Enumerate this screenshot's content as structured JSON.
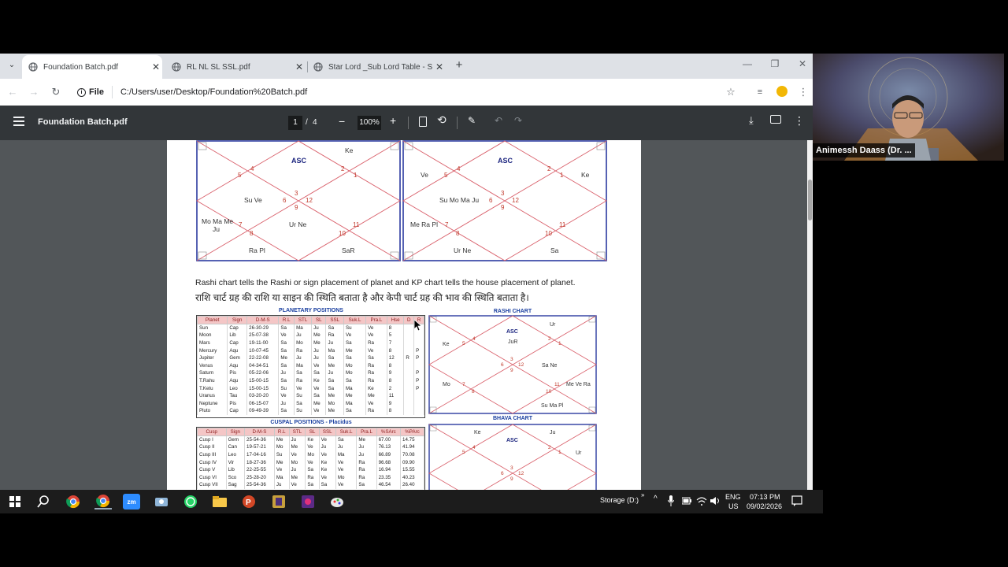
{
  "browser": {
    "tabs": [
      {
        "label": "Foundation Batch.pdf",
        "active": true
      },
      {
        "label": "RL NL SL SSL.pdf",
        "active": false
      },
      {
        "label": "Star Lord _Sub Lord Table - S",
        "active": false
      }
    ],
    "address": {
      "chip": "File",
      "url": "C:/Users/user/Desktop/Foundation%20Batch.pdf"
    }
  },
  "pdf": {
    "title": "Foundation Batch.pdf",
    "page_current": "1",
    "page_sep": "/",
    "page_total": "4",
    "zoom": "100%",
    "chart_left": {
      "asc": "ASC",
      "nums": [
        "4",
        "2",
        "5",
        "1",
        "3",
        "6",
        "12",
        "9",
        "7",
        "11",
        "8",
        "10"
      ],
      "houses": {
        "h1": "",
        "h2": "",
        "h3": "Ke",
        "h4": "Su Ve",
        "h5": "",
        "h6": "",
        "h7": "Ra Pl",
        "h8": "",
        "h9": "",
        "h10": "Ur Ne",
        "h11": "SaR",
        "h12": ""
      },
      "left_top": "Mo Ma Me",
      "left_bot": "Ju"
    },
    "chart_right": {
      "asc": "ASC",
      "nums": [
        "4",
        "2",
        "5",
        "1",
        "3",
        "6",
        "12",
        "9",
        "7",
        "11",
        "8",
        "10"
      ],
      "houses": {
        "tl": "Ve",
        "tr": "Ke",
        "mid_left": "Su Mo Ma Ju",
        "bl": "Me Ra Pl",
        "bottom": "Ur Ne",
        "br": "Sa"
      }
    },
    "sentence_en": "Rashi chart tells the Rashi or sign placement of planet and KP chart tells the house placement of planet.",
    "sentence_hi": "राशि चार्ट ग्रह की राशि या साइन की स्थिति बताता है और केपी चार्ट ग्रह की भाव की स्थिति बताता है।",
    "planetary": {
      "caption": "PLANETARY POSITIONS",
      "headers": [
        "Planet",
        "Sign",
        "D-M-S",
        "R.L",
        "STL",
        "SL",
        "SSL",
        "Suk.L",
        "Pra.L",
        "Hse",
        "D",
        "R"
      ],
      "rows": [
        [
          "Sun",
          "Cap",
          "26-30-29",
          "Sa",
          "Ma",
          "Ju",
          "Sa",
          "Su",
          "Ve",
          "8",
          "",
          ""
        ],
        [
          "Moon",
          "Lib",
          "25-07-38",
          "Ve",
          "Ju",
          "Me",
          "Ra",
          "Ve",
          "Ve",
          "5",
          "",
          ""
        ],
        [
          "Mars",
          "Cap",
          "19-11-00",
          "Sa",
          "Mo",
          "Me",
          "Ju",
          "Sa",
          "Ra",
          "7",
          "",
          ""
        ],
        [
          "Mercury",
          "Aqu",
          "10-07-45",
          "Sa",
          "Ra",
          "Ju",
          "Ma",
          "Me",
          "Ve",
          "8",
          "",
          "P"
        ],
        [
          "Jupiter",
          "Gem",
          "22-22-08",
          "Me",
          "Ju",
          "Ju",
          "Sa",
          "Sa",
          "Sa",
          "12",
          "R",
          "P"
        ],
        [
          "Venus",
          "Aqu",
          "04-34-51",
          "Sa",
          "Ma",
          "Ve",
          "Me",
          "Mo",
          "Ra",
          "8",
          "",
          ""
        ],
        [
          "Saturn",
          "Pis",
          "05-22-06",
          "Ju",
          "Sa",
          "Sa",
          "Ju",
          "Mo",
          "Ra",
          "9",
          "",
          "P"
        ],
        [
          "T.Rahu",
          "Aqu",
          "15-00-15",
          "Sa",
          "Ra",
          "Ke",
          "Sa",
          "Sa",
          "Ra",
          "8",
          "",
          "P"
        ],
        [
          "T.Ketu",
          "Leo",
          "15-00-15",
          "Su",
          "Ve",
          "Ve",
          "Sa",
          "Ma",
          "Ke",
          "2",
          "",
          "P"
        ],
        [
          "Uranus",
          "Tau",
          "03-20-20",
          "Ve",
          "Su",
          "Sa",
          "Me",
          "Me",
          "Me",
          "11",
          "",
          ""
        ],
        [
          "Neptune",
          "Pis",
          "06-15-07",
          "Ju",
          "Sa",
          "Me",
          "Mo",
          "Ma",
          "Ve",
          "9",
          "",
          ""
        ],
        [
          "Pluto",
          "Cap",
          "09-49-39",
          "Sa",
          "Su",
          "Ve",
          "Me",
          "Sa",
          "Ra",
          "8",
          "",
          ""
        ]
      ]
    },
    "cuspal": {
      "caption": "CUSPAL POSITIONS - Placidus",
      "headers": [
        "Cusp",
        "Sign",
        "D-M-S",
        "R.L",
        "STL",
        "SL",
        "SSL",
        "Suk.L",
        "Pra.L",
        "%SArc",
        "%PArc"
      ],
      "rows": [
        [
          "Cusp I",
          "Gem",
          "25-54-36",
          "Me",
          "Ju",
          "Ke",
          "Ve",
          "Sa",
          "Me",
          "67.00",
          "14.75"
        ],
        [
          "Cusp II",
          "Can",
          "19-57-21",
          "Mo",
          "Me",
          "Ve",
          "Ju",
          "Ju",
          "Ju",
          "76.13",
          "41.94"
        ],
        [
          "Cusp III",
          "Leo",
          "17-04-16",
          "Su",
          "Ve",
          "Mo",
          "Ve",
          "Ma",
          "Ju",
          "66.89",
          "70.08"
        ],
        [
          "Cusp IV",
          "Vir",
          "18-27-36",
          "Me",
          "Mo",
          "Ve",
          "Ke",
          "Ve",
          "Ra",
          "96.68",
          "09.90"
        ],
        [
          "Cusp V",
          "Lib",
          "22-25-55",
          "Ve",
          "Ju",
          "Sa",
          "Ke",
          "Ve",
          "Ra",
          "16.94",
          "15.55"
        ],
        [
          "Cusp VI",
          "Sco",
          "25-28-20",
          "Ma",
          "Me",
          "Ra",
          "Ve",
          "Mo",
          "Ra",
          "23.35",
          "40.23"
        ],
        [
          "Cusp VII",
          "Sag",
          "25-54-36",
          "Ju",
          "Ve",
          "Sa",
          "Sa",
          "Ve",
          "Sa",
          "46.54",
          "26.40"
        ]
      ]
    },
    "rashi": {
      "caption": "RASHI CHART",
      "asc": "ASC",
      "nums": [
        "4",
        "2",
        "5",
        "1",
        "3",
        "6",
        "12",
        "9",
        "7",
        "11",
        "8",
        "10"
      ],
      "top": "Ur",
      "asc_sub": "JuR",
      "left": "Ke",
      "right": "Sa Ne",
      "lower_left": "Mo",
      "lower_right": "Me Ve Ra",
      "bottom": "Su Ma Pl"
    },
    "bhava": {
      "caption": "BHAVA CHART",
      "asc": "ASC",
      "nums": [
        "4",
        "2",
        "5",
        "1",
        "3",
        "6",
        "12",
        "9"
      ],
      "tl": "Ke",
      "tr": "Ju",
      "right": "Ur"
    }
  },
  "video": {
    "name": "Animessh Daass (Dr. ..."
  },
  "taskbar": {
    "storage": "Storage (D:)",
    "lang1": "ENG",
    "lang2": "US",
    "time": "07:13 PM",
    "date": "09/02/2026"
  },
  "icons": [
    "dropdown-icon",
    "chrome-icon",
    "close-icon",
    "plus-icon",
    "back-icon",
    "forward-icon",
    "reload-icon",
    "info-icon",
    "star-icon",
    "media-icon",
    "profile-icon",
    "menu-icon",
    "hamburger-icon",
    "minus-icon",
    "plus-zoom-icon",
    "fit-icon",
    "rotate-icon",
    "annotate-icon",
    "undo-icon",
    "redo-icon",
    "download-icon",
    "print-icon",
    "more-icon",
    "windows-icon",
    "search-icon",
    "zoom-icon",
    "whatsapp-icon",
    "folder-icon",
    "powerpoint-icon",
    "wifi-icon",
    "volume-icon",
    "notification-icon"
  ],
  "colors": {
    "accent_red": "#c0392b",
    "chart_blue": "#1a237e",
    "table_header": "#f4c6c6"
  }
}
